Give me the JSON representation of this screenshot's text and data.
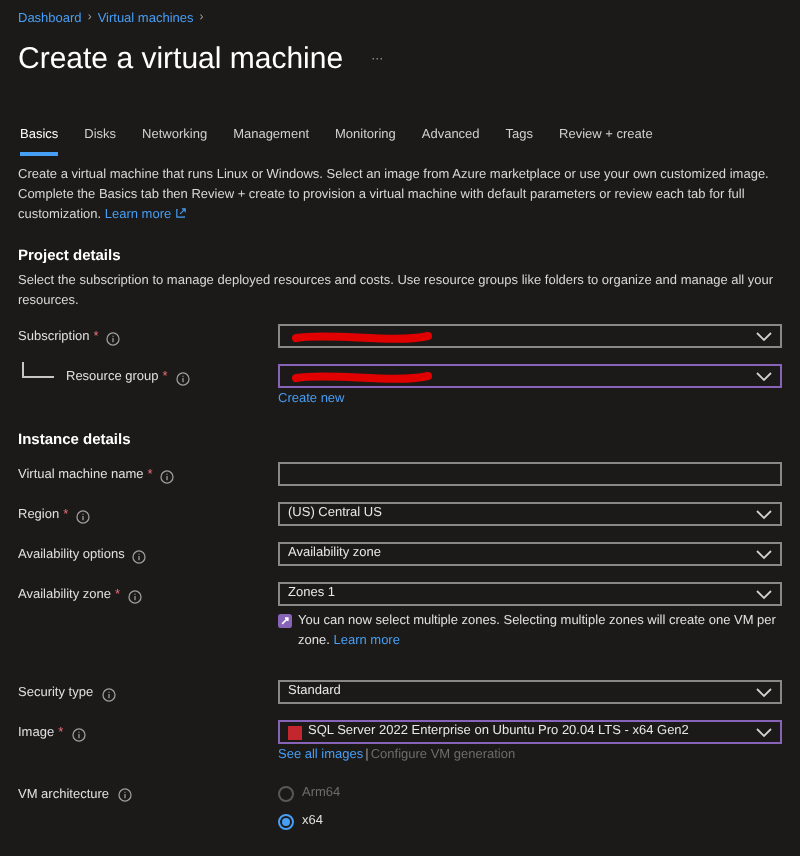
{
  "breadcrumb": [
    "Dashboard",
    "Virtual machines"
  ],
  "breadcrumb_separator": "›",
  "required_marker": "*",
  "title": "Create a virtual machine",
  "more": "···",
  "tabs": [
    {
      "label": "Basics",
      "selected": true
    },
    {
      "label": "Disks",
      "selected": false
    },
    {
      "label": "Networking",
      "selected": false
    },
    {
      "label": "Management",
      "selected": false
    },
    {
      "label": "Monitoring",
      "selected": false
    },
    {
      "label": "Advanced",
      "selected": false
    },
    {
      "label": "Tags",
      "selected": false
    },
    {
      "label": "Review + create",
      "selected": false
    }
  ],
  "intro": {
    "text": "Create a virtual machine that runs Linux or Windows. Select an image from Azure marketplace or use your own customized image. Complete the Basics tab then Review + create to provision a virtual machine with default parameters or review each tab for full customization.",
    "link": "Learn more"
  },
  "sections": [
    {
      "heading": "Project details",
      "description": "Select the subscription to manage deployed resources and costs. Use resource groups like folders to organize and manage all your resources.",
      "fields": [
        {
          "kind": "select",
          "label": "Subscription",
          "required": true,
          "redacted": true,
          "focused": false,
          "indented": false
        },
        {
          "kind": "select",
          "label": "Resource group",
          "required": true,
          "redacted": true,
          "focused": true,
          "indented": true,
          "links": [
            {
              "text": "Create new",
              "disabled": false
            }
          ]
        }
      ]
    },
    {
      "heading": "Instance details",
      "fields": [
        {
          "kind": "text",
          "label": "Virtual machine name",
          "required": true
        },
        {
          "kind": "select",
          "label": "Region",
          "required": true,
          "value": "(US) Central US",
          "focused": false
        },
        {
          "kind": "select",
          "label": "Availability options",
          "required": false,
          "value": "Availability zone",
          "focused": false
        },
        {
          "kind": "select",
          "label": "Availability zone",
          "required": true,
          "value": "Zones 1",
          "focused": false,
          "note": {
            "text": "You can now select multiple zones. Selecting multiple zones will create one VM per zone.",
            "link": "Learn more"
          }
        },
        {
          "kind": "select",
          "label": "Security type",
          "required": false,
          "value": "Standard",
          "focused": false
        },
        {
          "kind": "select",
          "label": "Image",
          "required": true,
          "value": "SQL Server 2022 Enterprise on Ubuntu Pro 20.04 LTS - x64 Gen2",
          "focused": true,
          "image_icon": true,
          "link_separator": "|",
          "links": [
            {
              "text": "See all images",
              "disabled": false
            },
            {
              "text": "Configure VM generation",
              "disabled": true
            }
          ]
        },
        {
          "kind": "radio",
          "label": "VM architecture",
          "required": false,
          "options": [
            {
              "label": "Arm64",
              "selected": false,
              "disabled": true
            },
            {
              "label": "x64",
              "selected": true,
              "disabled": false
            }
          ]
        }
      ]
    }
  ]
}
